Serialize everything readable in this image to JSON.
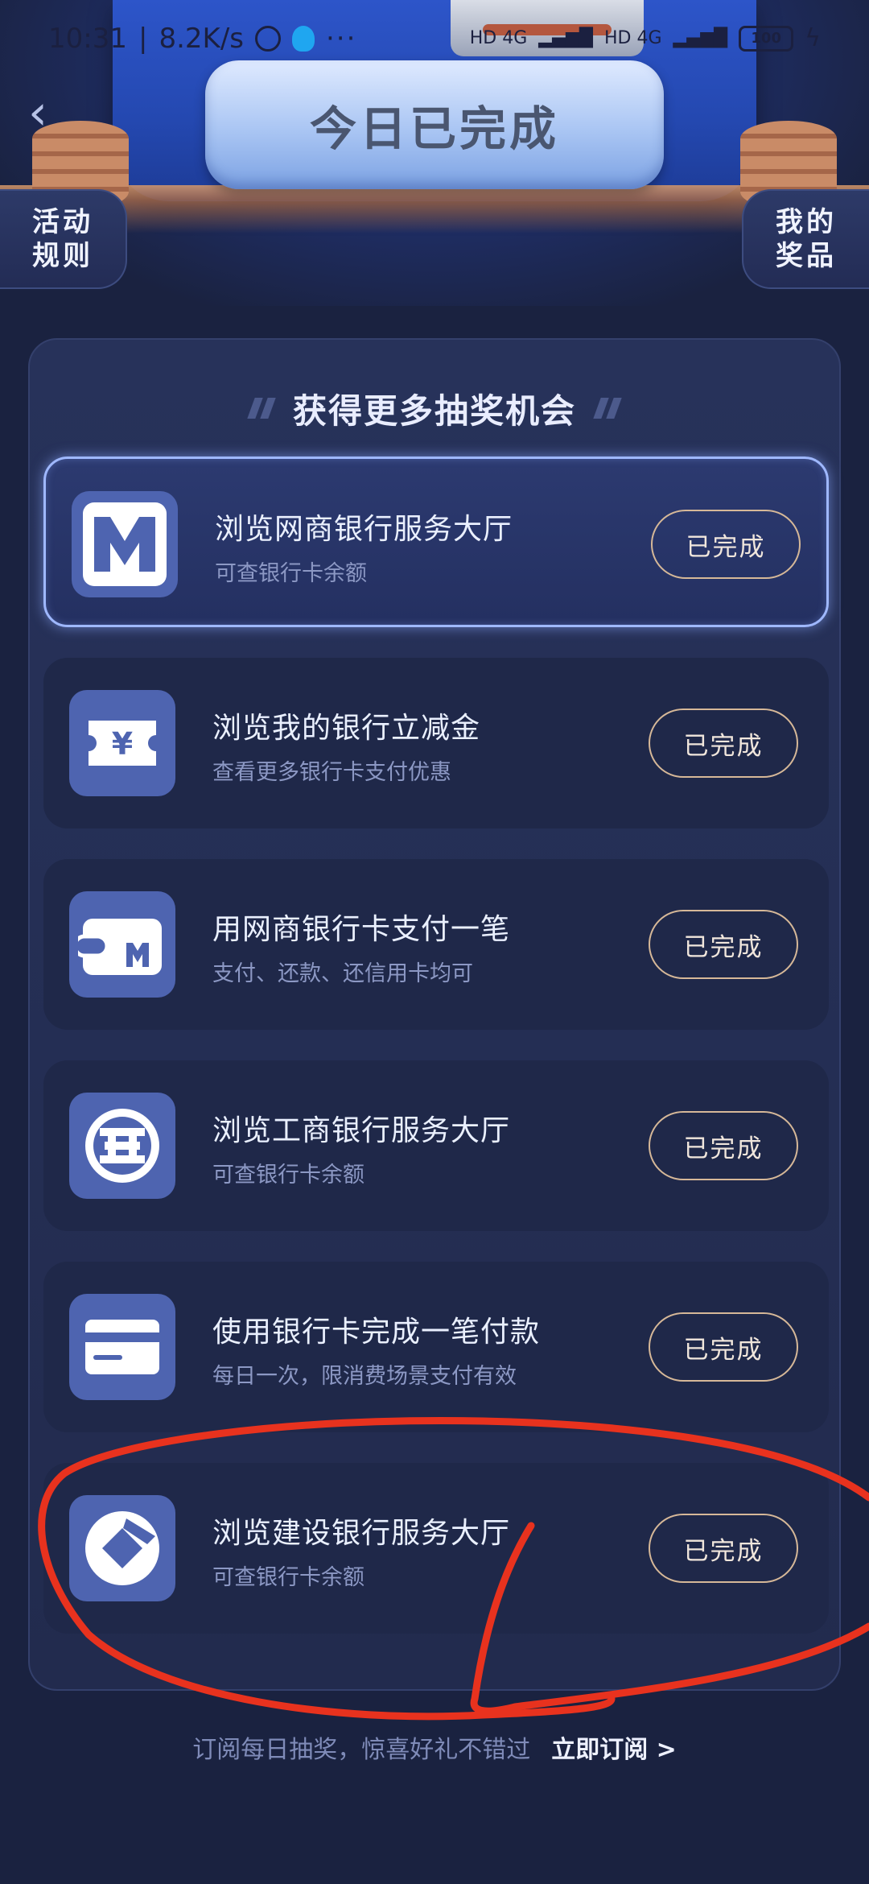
{
  "status_bar": {
    "time": "10:31",
    "network_speed": "8.2K/s",
    "dots": "···",
    "signal_1": "HD 4G",
    "signal_2": "HD 4G",
    "battery": "100"
  },
  "header": {
    "banner": "今日已完成",
    "rules_line1": "活动",
    "rules_line2": "规则",
    "prizes_line1": "我的",
    "prizes_line2": "奖品"
  },
  "card": {
    "title": "获得更多抽奖机会",
    "tasks": [
      {
        "title": "浏览网商银行服务大厅",
        "subtitle": "可查银行卡余额",
        "button": "已完成",
        "icon": "mybank-logo-icon"
      },
      {
        "title": "浏览我的银行立减金",
        "subtitle": "查看更多银行卡支付优惠",
        "button": "已完成",
        "icon": "yen-coupon-icon"
      },
      {
        "title": "用网商银行卡支付一笔",
        "subtitle": "支付、还款、还信用卡均可",
        "button": "已完成",
        "icon": "wallet-icon"
      },
      {
        "title": "浏览工商银行服务大厅",
        "subtitle": "可查银行卡余额",
        "button": "已完成",
        "icon": "icbc-logo-icon"
      },
      {
        "title": "使用银行卡完成一笔付款",
        "subtitle": "每日一次，限消费场景支付有效",
        "button": "已完成",
        "icon": "bank-card-icon"
      },
      {
        "title": "浏览建设银行服务大厅",
        "subtitle": "可查银行卡余额",
        "button": "已完成",
        "icon": "ccb-logo-icon"
      }
    ]
  },
  "footer": {
    "text": "订阅每日抽奖，惊喜好礼不错过",
    "link": "立即订阅 >"
  },
  "colors": {
    "background": "#1a2240",
    "icon_bg": "#4e64b0",
    "button_border": "#d6b898",
    "annotation": "#e8321e"
  }
}
